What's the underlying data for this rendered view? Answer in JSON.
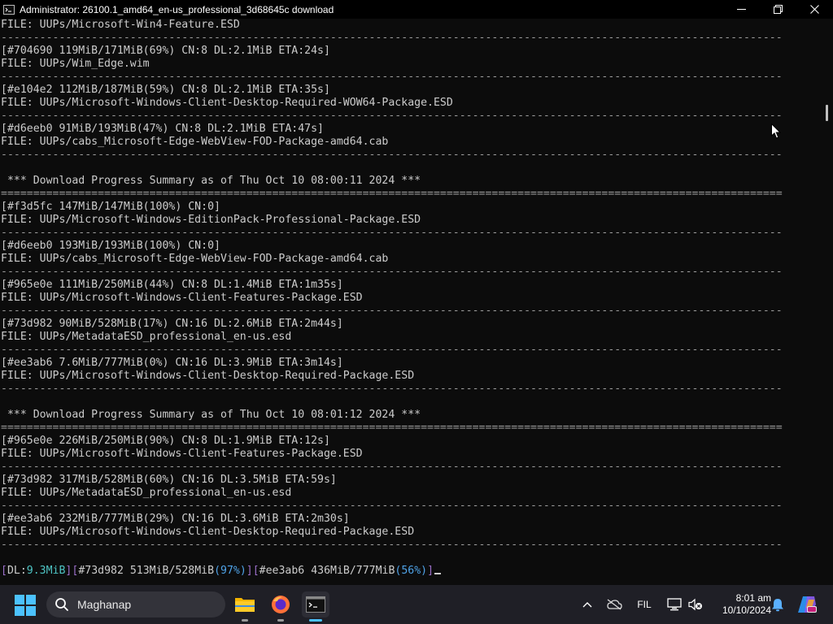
{
  "window": {
    "title": "Administrator:  26100.1_amd64_en-us_professional_3d68645c download"
  },
  "console_lines": [
    {
      "text": "FILE: UUPs/Microsoft-Win4-Feature.ESD",
      "kind": "text"
    },
    {
      "text": "-------------------------------------------------------------------------------------------------------------------------",
      "kind": "sep"
    },
    {
      "text": "[#704690 119MiB/171MiB(69%) CN:8 DL:2.1MiB ETA:24s]",
      "kind": "text"
    },
    {
      "text": "FILE: UUPs/Wim_Edge.wim",
      "kind": "text"
    },
    {
      "text": "-------------------------------------------------------------------------------------------------------------------------",
      "kind": "sep"
    },
    {
      "text": "[#e104e2 112MiB/187MiB(59%) CN:8 DL:2.1MiB ETA:35s]",
      "kind": "text"
    },
    {
      "text": "FILE: UUPs/Microsoft-Windows-Client-Desktop-Required-WOW64-Package.ESD",
      "kind": "text"
    },
    {
      "text": "-------------------------------------------------------------------------------------------------------------------------",
      "kind": "sep"
    },
    {
      "text": "[#d6eeb0 91MiB/193MiB(47%) CN:8 DL:2.1MiB ETA:47s]",
      "kind": "text"
    },
    {
      "text": "FILE: UUPs/cabs_Microsoft-Edge-WebView-FOD-Package-amd64.cab",
      "kind": "text"
    },
    {
      "text": "-------------------------------------------------------------------------------------------------------------------------",
      "kind": "sep"
    },
    {
      "text": "",
      "kind": "text"
    },
    {
      "text": " *** Download Progress Summary as of Thu Oct 10 08:00:11 2024 ***",
      "kind": "text"
    },
    {
      "text": "=========================================================================================================================",
      "kind": "sep"
    },
    {
      "text": "[#f3d5fc 147MiB/147MiB(100%) CN:0]",
      "kind": "text"
    },
    {
      "text": "FILE: UUPs/Microsoft-Windows-EditionPack-Professional-Package.ESD",
      "kind": "text"
    },
    {
      "text": "-------------------------------------------------------------------------------------------------------------------------",
      "kind": "sep"
    },
    {
      "text": "[#d6eeb0 193MiB/193MiB(100%) CN:0]",
      "kind": "text"
    },
    {
      "text": "FILE: UUPs/cabs_Microsoft-Edge-WebView-FOD-Package-amd64.cab",
      "kind": "text"
    },
    {
      "text": "-------------------------------------------------------------------------------------------------------------------------",
      "kind": "sep"
    },
    {
      "text": "[#965e0e 111MiB/250MiB(44%) CN:8 DL:1.4MiB ETA:1m35s]",
      "kind": "text"
    },
    {
      "text": "FILE: UUPs/Microsoft-Windows-Client-Features-Package.ESD",
      "kind": "text"
    },
    {
      "text": "-------------------------------------------------------------------------------------------------------------------------",
      "kind": "sep"
    },
    {
      "text": "[#73d982 90MiB/528MiB(17%) CN:16 DL:2.6MiB ETA:2m44s]",
      "kind": "text"
    },
    {
      "text": "FILE: UUPs/MetadataESD_professional_en-us.esd",
      "kind": "text"
    },
    {
      "text": "-------------------------------------------------------------------------------------------------------------------------",
      "kind": "sep"
    },
    {
      "text": "[#ee3ab6 7.6MiB/777MiB(0%) CN:16 DL:3.9MiB ETA:3m14s]",
      "kind": "text"
    },
    {
      "text": "FILE: UUPs/Microsoft-Windows-Client-Desktop-Required-Package.ESD",
      "kind": "text"
    },
    {
      "text": "-------------------------------------------------------------------------------------------------------------------------",
      "kind": "sep"
    },
    {
      "text": "",
      "kind": "text"
    },
    {
      "text": " *** Download Progress Summary as of Thu Oct 10 08:01:12 2024 ***",
      "kind": "text"
    },
    {
      "text": "=========================================================================================================================",
      "kind": "sep"
    },
    {
      "text": "[#965e0e 226MiB/250MiB(90%) CN:8 DL:1.9MiB ETA:12s]",
      "kind": "text"
    },
    {
      "text": "FILE: UUPs/Microsoft-Windows-Client-Features-Package.ESD",
      "kind": "text"
    },
    {
      "text": "-------------------------------------------------------------------------------------------------------------------------",
      "kind": "sep"
    },
    {
      "text": "[#73d982 317MiB/528MiB(60%) CN:16 DL:3.5MiB ETA:59s]",
      "kind": "text"
    },
    {
      "text": "FILE: UUPs/MetadataESD_professional_en-us.esd",
      "kind": "text"
    },
    {
      "text": "-------------------------------------------------------------------------------------------------------------------------",
      "kind": "sep"
    },
    {
      "text": "[#ee3ab6 232MiB/777MiB(29%) CN:16 DL:3.6MiB ETA:2m30s]",
      "kind": "text"
    },
    {
      "text": "FILE: UUPs/Microsoft-Windows-Client-Desktop-Required-Package.ESD",
      "kind": "text"
    },
    {
      "text": "-------------------------------------------------------------------------------------------------------------------------",
      "kind": "sep"
    },
    {
      "text": "",
      "kind": "text"
    }
  ],
  "status_line": {
    "open1": "[",
    "dl_label": "DL:",
    "dl_value": "9.3MiB",
    "close1": "]",
    "open2": "[",
    "item1": "#73d982 513MiB/528MiB",
    "item1_pct": "(97%)",
    "close2": "]",
    "open3": "[",
    "item2": "#ee3ab6 436MiB/777MiB",
    "item2_pct": "(56%)",
    "close3": "]"
  },
  "taskbar": {
    "search_placeholder": "Maghanap",
    "language": "FIL",
    "time": "8:01 am",
    "date": "10/10/2024"
  },
  "colors": {
    "console_bg": "#0c0c0c",
    "console_text": "#cccccc",
    "status_bracket": "#9b6fc8",
    "status_dl_value": "#4ec4c4",
    "status_percent": "#4fa3e8",
    "taskbar_bg": "#1f1f26"
  }
}
